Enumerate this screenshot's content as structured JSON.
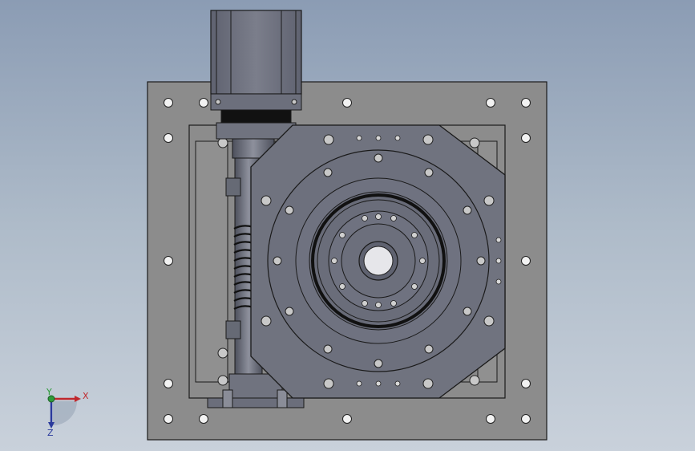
{
  "view": {
    "background_top": "#8b9cb4",
    "background_bottom": "#c9d1db"
  },
  "model": {
    "plate_color": "#8c8c8c",
    "part_color": "#6e7180",
    "motor_color": "#6f727f",
    "edge_color": "#1a1a1a"
  },
  "triad": {
    "x_label": "X",
    "y_label": "Y",
    "z_label": "Z",
    "x_color": "#c0282d",
    "y_color": "#2e9b3a",
    "z_color": "#2a3a9c"
  }
}
